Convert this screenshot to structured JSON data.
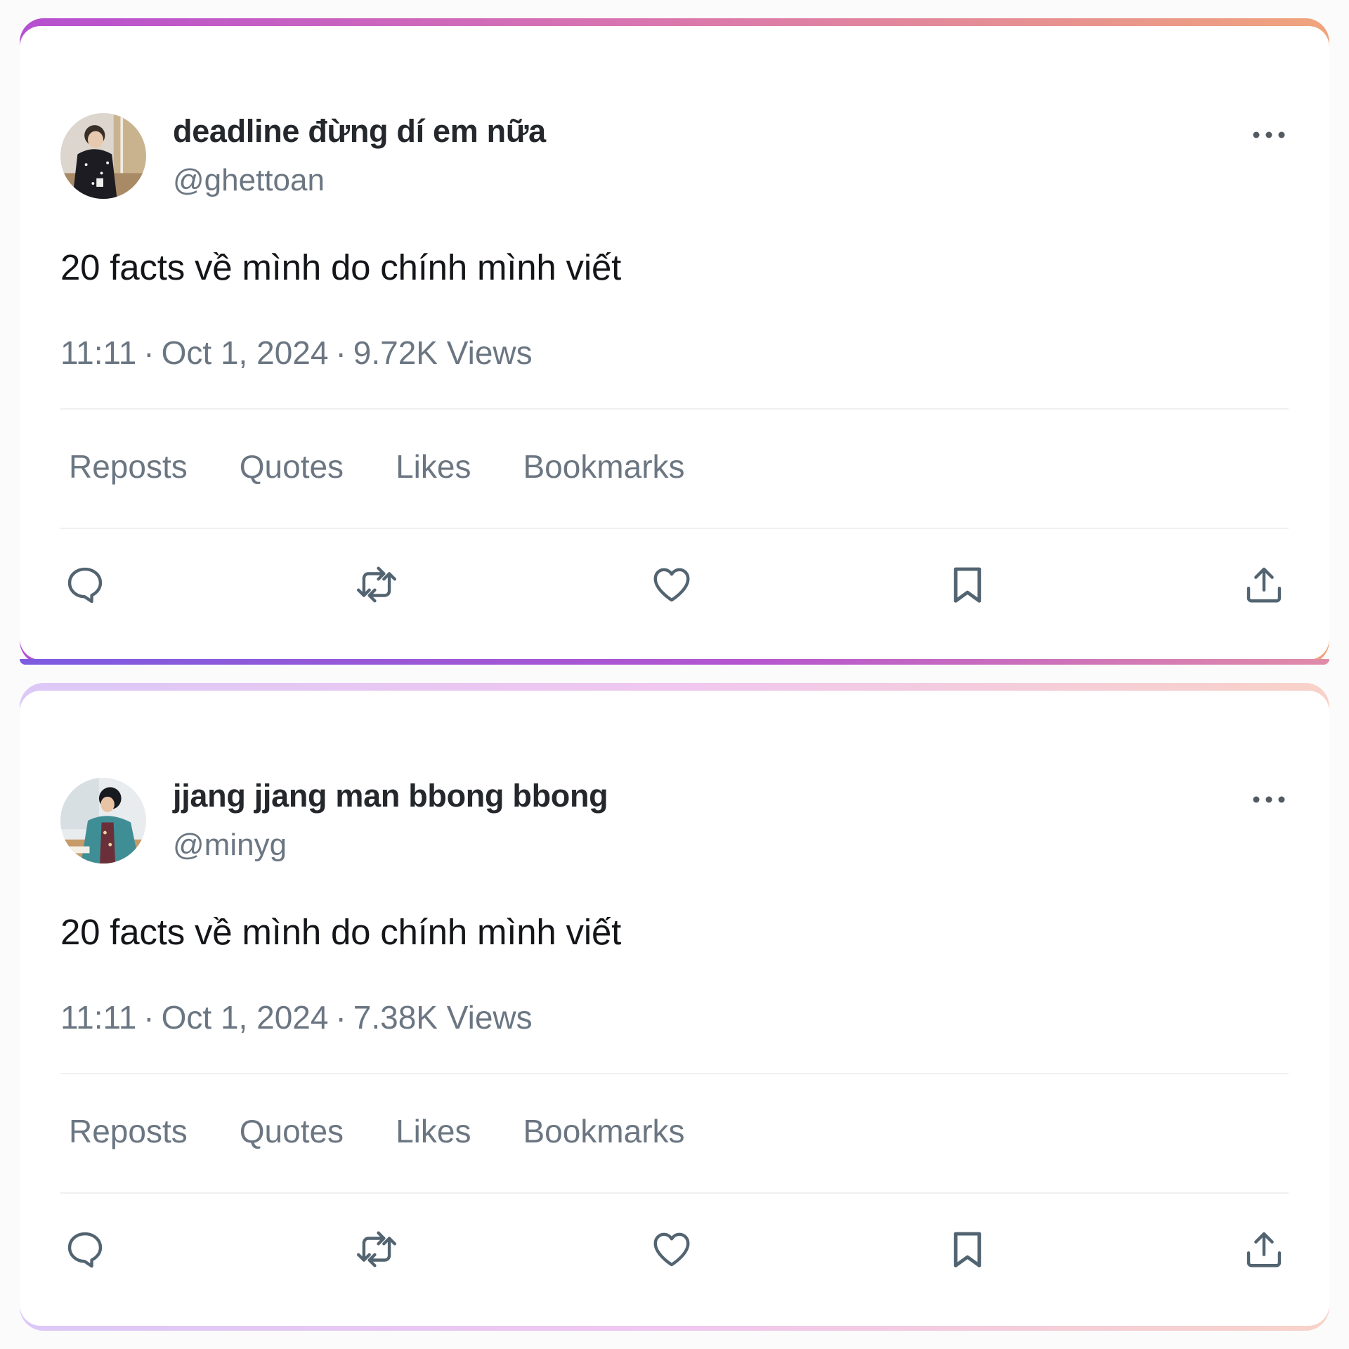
{
  "posts": [
    {
      "display_name": "deadline đừng dí em nữa",
      "handle": "@ghettoan",
      "text": "20 facts về mình do chính mình viết",
      "time": "11:11",
      "date": "Oct 1, 2024",
      "views": "9.72K Views",
      "stat_links": [
        "Reposts",
        "Quotes",
        "Likes",
        "Bookmarks"
      ],
      "more_icon": "more-horizontal-icon"
    },
    {
      "display_name": "jjang jjang man bbong bbong",
      "handle": "@minyg",
      "text": "20 facts về mình do chính mình viết",
      "time": "11:11",
      "date": "Oct 1, 2024",
      "views": "7.38K Views",
      "stat_links": [
        "Reposts",
        "Quotes",
        "Likes",
        "Bookmarks"
      ],
      "more_icon": "more-horizontal-icon"
    }
  ],
  "meta_separator": "·",
  "action_icons": [
    "reply-icon",
    "repost-icon",
    "like-icon",
    "bookmark-icon",
    "share-icon"
  ],
  "colors": {
    "text_primary": "#131518",
    "text_secondary": "#6b7682",
    "frame_1_gradient": [
      "#b64fd0",
      "#d873b2",
      "#f0a47c"
    ],
    "frame_2_gradient": [
      "#dcc8f7",
      "#f0c7ef",
      "#f8d2c8"
    ]
  }
}
